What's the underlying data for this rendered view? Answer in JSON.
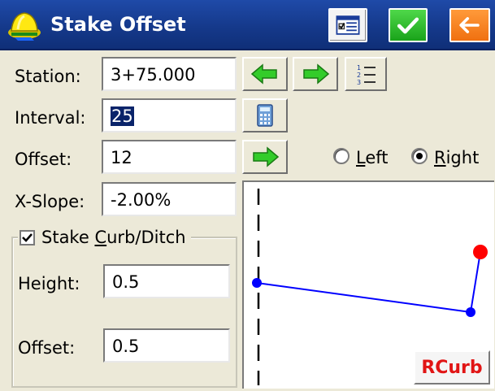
{
  "window": {
    "title": "Stake Offset"
  },
  "fields": {
    "station": {
      "label": "Station:",
      "value": "3+75.000"
    },
    "interval": {
      "label": "Interval:",
      "value": "25"
    },
    "offset": {
      "label": "Offset:",
      "value": "12"
    },
    "xslope": {
      "label": "X-Slope:",
      "value": "-2.00%"
    }
  },
  "side": {
    "left_label": "Left",
    "right_label": "Right",
    "selected": "Right"
  },
  "curb": {
    "checkbox_prefix": "Stake ",
    "checkbox_underlined": "C",
    "checkbox_suffix": "urb/Ditch",
    "checked": true,
    "height": {
      "label": "Height:",
      "value": "0.5"
    },
    "offset": {
      "label": "Offset:",
      "value": "0.5"
    }
  },
  "diagram": {
    "mode_button": "RCurb",
    "line_color": "#0000ff",
    "point_color": "#0000ff",
    "target_color": "#ff0000"
  },
  "icons": {
    "app": "hardhat-icon",
    "form": "form-icon",
    "ok": "check-icon",
    "back": "back-arrow-icon",
    "prev": "left-arrow-icon",
    "next": "right-arrow-icon",
    "list": "numbered-list-icon",
    "calc": "calculator-icon"
  }
}
